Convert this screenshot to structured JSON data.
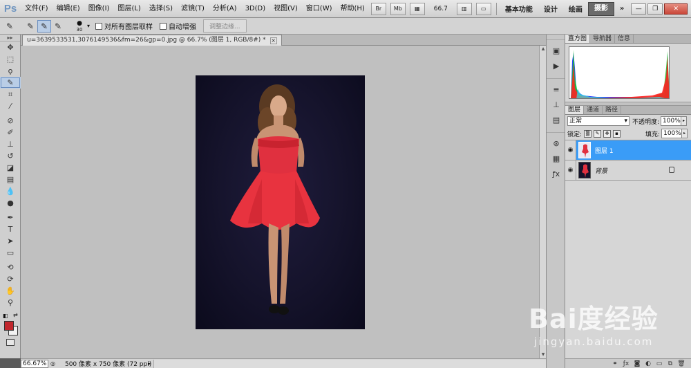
{
  "app": {
    "logo": "Ps",
    "menu": [
      "文件(F)",
      "编辑(E)",
      "图像(I)",
      "图层(L)",
      "选择(S)",
      "滤镜(T)",
      "分析(A)",
      "3D(D)",
      "视图(V)",
      "窗口(W)",
      "帮助(H)"
    ],
    "bridge_label": "Br",
    "minibridge_label": "Mb",
    "zoom_value": "66.7",
    "workspaces": [
      "基本功能",
      "设计",
      "绘画"
    ],
    "workspace_active": "摄影",
    "more_label": "»"
  },
  "options": {
    "brush_size": "30",
    "sample_all_label": "对所有图层取样",
    "auto_enhance_label": "自动增强",
    "refine_edge_label": "调整边缘..."
  },
  "document": {
    "tab_title": "u=3639533531,3076149536&fm=26&gp=0.jpg @ 66.7% (图层 1, RGB/8#) *",
    "close_label": "×"
  },
  "status": {
    "zoom": "66.67%",
    "doc_info": "500 像素 x 750 像素 (72 ppi)"
  },
  "histogram_panel": {
    "tabs": [
      "直方图",
      "导航器",
      "信息"
    ],
    "active": 0
  },
  "layers_panel": {
    "tabs": [
      "图层",
      "通道",
      "路径"
    ],
    "active": 0,
    "blend_mode": "正常",
    "opacity_label": "不透明度:",
    "opacity": "100%",
    "lock_label": "锁定:",
    "fill_label": "填充:",
    "fill": "100%",
    "layers": [
      {
        "name": "图层 1",
        "selected": true,
        "locked": false
      },
      {
        "name": "背景",
        "selected": false,
        "locked": true
      }
    ],
    "footer_icons": [
      "link-icon",
      "fx-icon",
      "mask-icon",
      "adjustment-icon",
      "group-icon",
      "new-layer-icon",
      "trash-icon"
    ]
  },
  "colors": {
    "foreground": "#c1272d",
    "background": "#f2f2f2",
    "selection": "#3a9cf7"
  },
  "watermark": {
    "logo": "Bai度经验",
    "url": "jingyan.baidu.com"
  }
}
